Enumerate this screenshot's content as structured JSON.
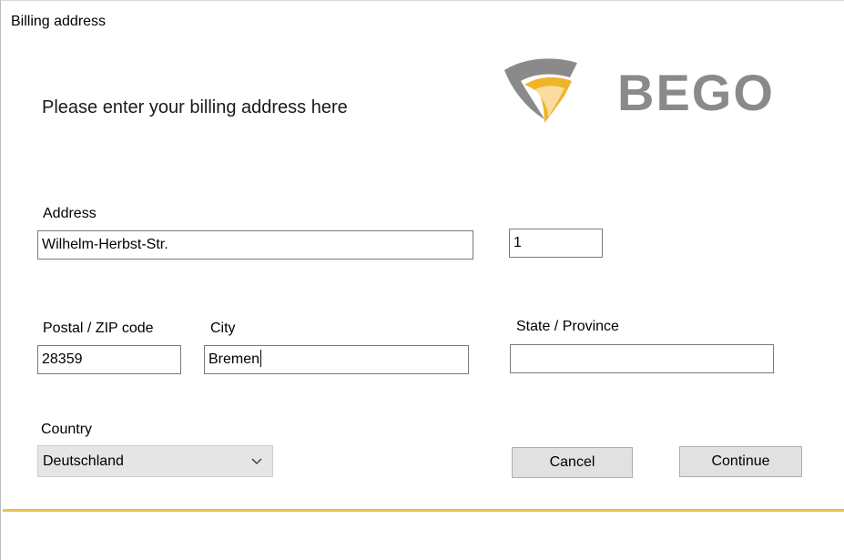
{
  "window": {
    "title": "Billing address"
  },
  "header": {
    "heading": "Please enter your billing address here",
    "logo_text": "BEGO"
  },
  "form": {
    "address_label": "Address",
    "street_value": "Wilhelm-Herbst-Str.",
    "house_number_value": "1",
    "postal_label": "Postal / ZIP code",
    "postal_value": "28359",
    "city_label": "City",
    "city_value": "Bremen",
    "state_label": "State / Province",
    "state_value": "",
    "country_label": "Country",
    "country_selected": "Deutschland"
  },
  "buttons": {
    "cancel_label": "Cancel",
    "continue_label": "Continue"
  },
  "colors": {
    "accent_gold": "#e9c14d",
    "logo_gray": "#8a8a8a",
    "logo_yellow": "#f0b429"
  },
  "icons": {
    "dropdown": "chevron-down-icon"
  }
}
